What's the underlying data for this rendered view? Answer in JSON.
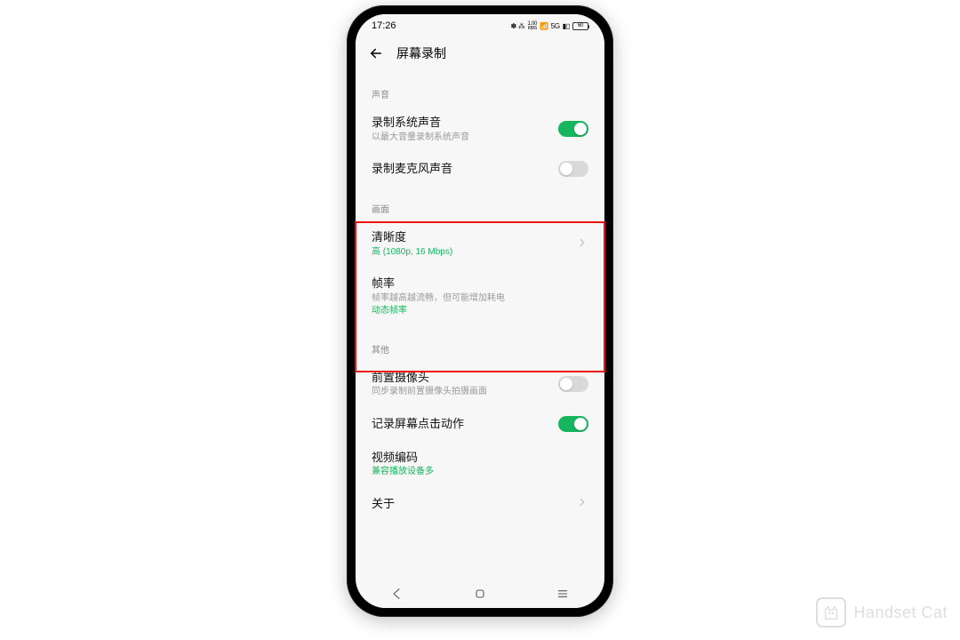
{
  "status": {
    "time": "17:26",
    "net_label": "KB/S",
    "net_value": "1.00",
    "signal": "5G",
    "battery_text": "60"
  },
  "header": {
    "title": "屏幕录制"
  },
  "sections": {
    "sound": {
      "label": "声音",
      "items": {
        "system_sound": {
          "title": "录制系统声音",
          "sub": "以最大音量录制系统声音",
          "on": true
        },
        "mic_sound": {
          "title": "录制麦克风声音",
          "on": false
        }
      }
    },
    "picture": {
      "label": "画面",
      "items": {
        "clarity": {
          "title": "清晰度",
          "value": "高 (1080p, 16 Mbps)"
        },
        "fps": {
          "title": "帧率",
          "sub": "帧率越高越流畅，但可能增加耗电",
          "value": "动态帧率"
        }
      }
    },
    "other": {
      "label": "其他",
      "items": {
        "front_cam": {
          "title": "前置摄像头",
          "sub": "同步录制前置摄像头拍摄画面",
          "on": false
        },
        "touches": {
          "title": "记录屏幕点击动作",
          "on": true
        },
        "encoding": {
          "title": "视频编码",
          "value": "兼容播放设备多"
        },
        "about": {
          "title": "关于"
        }
      }
    }
  },
  "watermark": {
    "text": "Handset Cat"
  },
  "colors": {
    "accent": "#17b55e",
    "highlight": "#e11"
  }
}
